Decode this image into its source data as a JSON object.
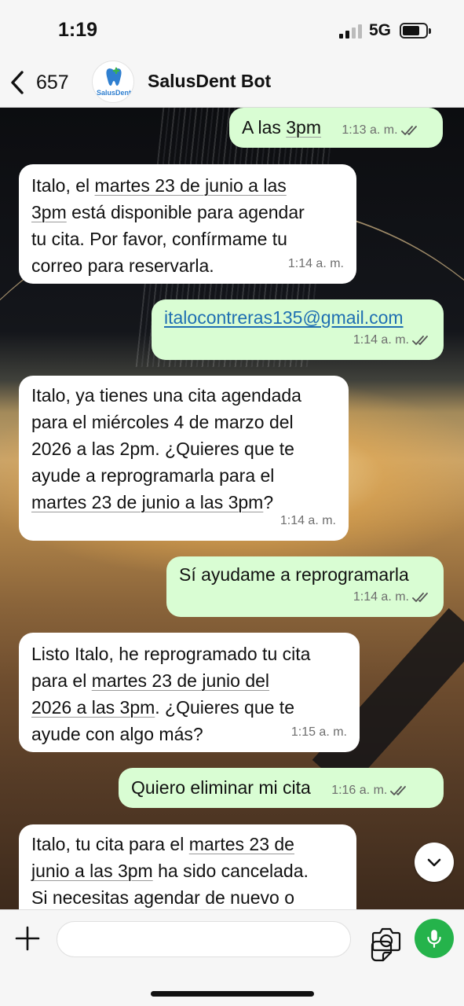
{
  "status_bar": {
    "time": "1:19",
    "network": "5G"
  },
  "header": {
    "back_count": "657",
    "contact_name": "SalusDent Bot",
    "avatar_logo_text": "SalusDent"
  },
  "messages": [
    {
      "direction": "out",
      "parts": [
        {
          "t": "A las "
        },
        {
          "t": "3pm",
          "u": true
        }
      ],
      "time": "1:13 a. m.",
      "ticks": true
    },
    {
      "direction": "in",
      "lines": [
        [
          {
            "t": "Italo, el "
          },
          {
            "t": "martes 23 de junio a las",
            "u": true
          }
        ],
        [
          {
            "t": "3pm",
            "u": true
          },
          {
            "t": " está disponible para agendar"
          }
        ],
        [
          {
            "t": "tu cita. Por favor, confírmame tu"
          }
        ],
        [
          {
            "t": "correo para reservarla."
          }
        ]
      ],
      "time": "1:14 a. m."
    },
    {
      "direction": "out",
      "parts": [
        {
          "t": "italocontreras135@gmail.com",
          "link": true
        }
      ],
      "time": "1:14 a. m.",
      "ticks": true
    },
    {
      "direction": "in",
      "lines": [
        [
          {
            "t": "Italo, ya tienes una cita agendada"
          }
        ],
        [
          {
            "t": "para el miércoles 4 de marzo del"
          }
        ],
        [
          {
            "t": "2026 a las 2pm. ¿Quieres que te"
          }
        ],
        [
          {
            "t": "ayude a reprogramarla para el"
          }
        ],
        [
          {
            "t": "martes 23 de junio a las 3pm",
            "u": true
          },
          {
            "t": "?"
          }
        ]
      ],
      "time": "1:14 a. m."
    },
    {
      "direction": "out",
      "parts": [
        {
          "t": "Sí ayudame a reprogramarla"
        }
      ],
      "time": "1:14 a. m.",
      "ticks": true
    },
    {
      "direction": "in",
      "lines": [
        [
          {
            "t": "Listo Italo, he reprogramado tu cita"
          }
        ],
        [
          {
            "t": "para el "
          },
          {
            "t": "martes 23 de junio del",
            "u": true
          }
        ],
        [
          {
            "t": "2026 a las 3pm",
            "u": true
          },
          {
            "t": ". ¿Quieres que te"
          }
        ],
        [
          {
            "t": "ayude con algo más?"
          }
        ]
      ],
      "time": "1:15 a. m."
    },
    {
      "direction": "out",
      "parts": [
        {
          "t": "Quiero eliminar mi cita"
        }
      ],
      "time": "1:16 a. m.",
      "ticks": true
    },
    {
      "direction": "in",
      "lines": [
        [
          {
            "t": "Italo, tu cita para el "
          },
          {
            "t": "martes 23 de",
            "u": true
          }
        ],
        [
          {
            "t": "junio a las 3pm",
            "u": true
          },
          {
            "t": " ha sido cancelada."
          }
        ],
        [
          {
            "t": "Si necesitas agendar de nuevo o"
          }
        ]
      ],
      "time": ""
    }
  ],
  "icons": {
    "back": "chevron-left-icon",
    "scroll": "chevron-down-icon",
    "attach": "plus-icon",
    "sticker": "sticker-icon",
    "camera": "camera-icon",
    "mic": "microphone-icon"
  },
  "colors": {
    "outgoing_bubble": "#d9fdd3",
    "incoming_bubble": "#ffffff",
    "mic_button": "#25b34b"
  }
}
